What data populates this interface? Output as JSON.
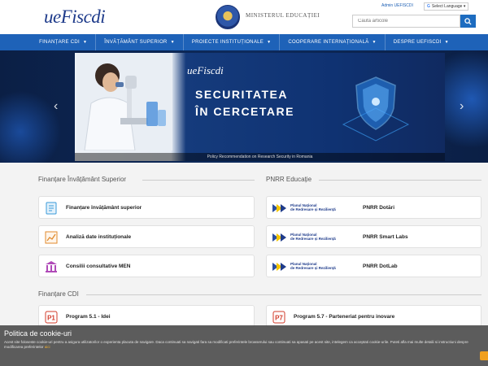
{
  "header": {
    "logo": "ueFiscdi",
    "ministry": "MINISTERUL EDUCAȚIEI",
    "admin_link": "Admin UEFISCDI",
    "language_select": "Select Language",
    "search_placeholder": "Caută articole"
  },
  "nav": {
    "items": [
      {
        "label": "FINANȚARE CDI"
      },
      {
        "label": "ÎNVĂȚĂMÂNT SUPERIOR"
      },
      {
        "label": "PROIECTE INSTITUȚIONALE"
      },
      {
        "label": "COOPERARE INTERNAȚIONALĂ"
      },
      {
        "label": "DESPRE UEFISCDI"
      }
    ]
  },
  "hero": {
    "logo": "ueFiscdi",
    "title_line1": "SECURITATEA",
    "title_line2": "ÎN CERCETARE",
    "caption": "Policy Recommendation on Research Security in Romania"
  },
  "sections": {
    "higher_ed": {
      "title": "Finanțare Învățământ Superior",
      "cards": [
        {
          "label": "Finanțare învățământ superior",
          "icon": "document-icon"
        },
        {
          "label": "Analiză date instituționale",
          "icon": "chart-icon"
        },
        {
          "label": "Consilii consultative MEN",
          "icon": "institution-icon"
        }
      ]
    },
    "pnrr": {
      "title": "PNRR Educație",
      "logo_text_line1": "Planul Național",
      "logo_text_line2": "de Redresare și Reziliență",
      "cards": [
        {
          "label": "PNRR Dotări"
        },
        {
          "label": "PNRR Smart Labs"
        },
        {
          "label": "PNRR DotLab"
        }
      ]
    },
    "cdi": {
      "title": "Finanțare CDI",
      "cards": [
        {
          "label": "Program 5.1 - Idei",
          "badge": "P1"
        },
        {
          "label": "Program 5.7 - Parteneriat pentru inovare",
          "badge": "P7"
        }
      ]
    }
  },
  "cookie": {
    "title": "Politica de cookie-uri",
    "text": "Acest site foloseste cookie-uri pentru a asigura utilizatorilor o experienta placuta de navigare. Daca continuati sa navigati fara sa modificati preferintele browserului sau continuati sa apasati pe acest site, intelegem ca acceptati cookie-urile. Puteti afla mai multe detalii si instructiuni despre modificarea preferintelor",
    "more_link": "aici"
  },
  "colors": {
    "primary": "#1e62b8",
    "brand_dark": "#1d3a8a",
    "cookie_accent": "#f0a020"
  }
}
